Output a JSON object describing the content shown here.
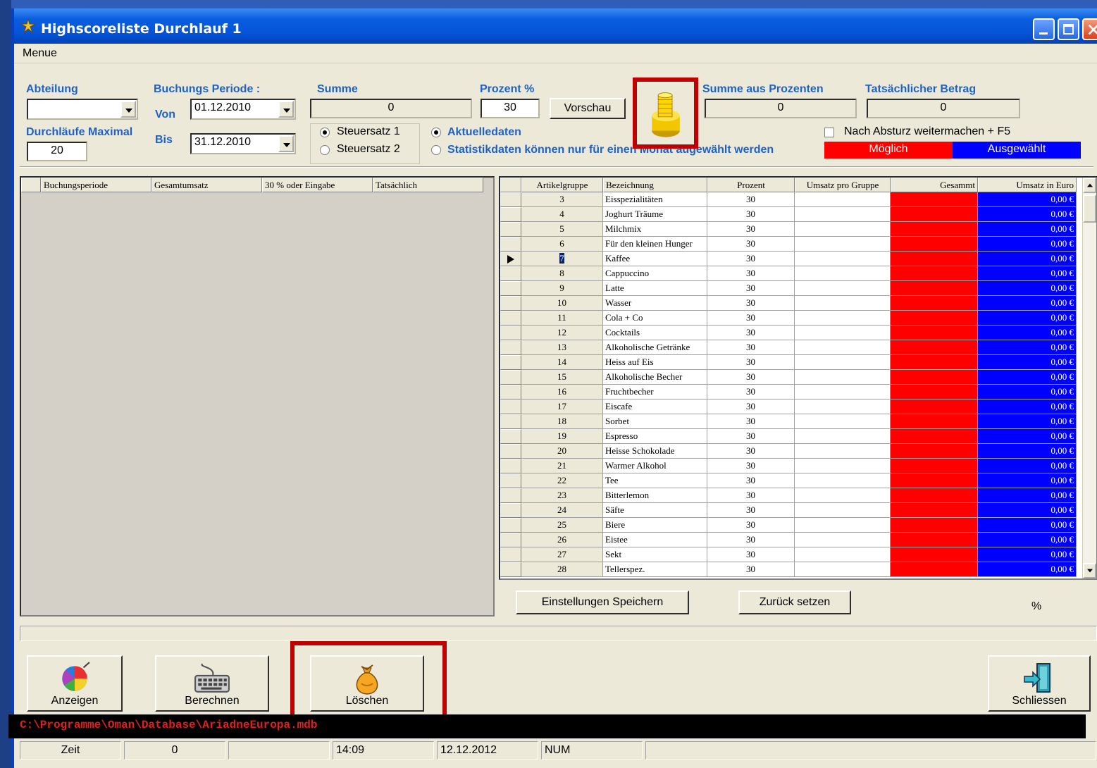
{
  "window": {
    "title": "Highscoreliste Durchlauf 1",
    "menu": "Menue"
  },
  "filters": {
    "abteilung_label": "Abteilung",
    "abteilung_value": "",
    "durchlaeufe_label": "Durchläufe Maximal",
    "durchlaeufe_value": "20",
    "periode_label": "Buchungs Periode :",
    "von_label": "Von",
    "von_value": "01.12.2010",
    "bis_label": "Bis",
    "bis_value": "31.12.2010",
    "summe_label": "Summe",
    "summe_value": "0",
    "prozent_label": "Prozent %",
    "prozent_value": "30",
    "vorschau_label": "Vorschau",
    "summe_prozent_label": "Summe aus Prozenten",
    "summe_prozent_value": "0",
    "betrag_label": "Tatsächlicher Betrag",
    "betrag_value": "0",
    "steuersatz1": "Steuersatz 1",
    "steuersatz2": "Steuersatz 2",
    "aktuelledaten": "Aktuelledaten",
    "statistikdaten": "Statistikdaten können nur für einen Monat augewählt werden",
    "absturz_label": "Nach Absturz weitermachen + F5",
    "moeglich_label": "Möglich",
    "ausgewaehlt_label": "Ausgewählt",
    "colors": {
      "moeglich": "#ff0000",
      "ausgewaehlt": "#0000ff"
    }
  },
  "left_grid": {
    "headers": [
      "Buchungsperiode",
      "Gesamtumsatz",
      "30 % oder Eingabe",
      "Tatsächlich"
    ]
  },
  "right_grid": {
    "headers": [
      "Artikelgruppe",
      "Bezeichnung",
      "Prozent",
      "Umsatz pro Gruppe",
      "Gesammt",
      "Umsatz in Euro"
    ],
    "current_row_index": 4,
    "rows": [
      {
        "grp": "3",
        "name": "Eisspezialitäten",
        "pct": "30",
        "eur": "0,00 €"
      },
      {
        "grp": "4",
        "name": "Joghurt Träume",
        "pct": "30",
        "eur": "0,00 €"
      },
      {
        "grp": "5",
        "name": "Milchmix",
        "pct": "30",
        "eur": "0,00 €"
      },
      {
        "grp": "6",
        "name": "Für den kleinen Hunger",
        "pct": "30",
        "eur": "0,00 €"
      },
      {
        "grp": "7",
        "name": "Kaffee",
        "pct": "30",
        "eur": "0,00 €"
      },
      {
        "grp": "8",
        "name": "Cappuccino",
        "pct": "30",
        "eur": "0,00 €"
      },
      {
        "grp": "9",
        "name": "Latte",
        "pct": "30",
        "eur": "0,00 €"
      },
      {
        "grp": "10",
        "name": "Wasser",
        "pct": "30",
        "eur": "0,00 €"
      },
      {
        "grp": "11",
        "name": "Cola + Co",
        "pct": "30",
        "eur": "0,00 €"
      },
      {
        "grp": "12",
        "name": "Cocktails",
        "pct": "30",
        "eur": "0,00 €"
      },
      {
        "grp": "13",
        "name": "Alkoholische Getränke",
        "pct": "30",
        "eur": "0,00 €"
      },
      {
        "grp": "14",
        "name": "Heiss auf Eis",
        "pct": "30",
        "eur": "0,00 €"
      },
      {
        "grp": "15",
        "name": "Alkoholische Becher",
        "pct": "30",
        "eur": "0,00 €"
      },
      {
        "grp": "16",
        "name": "Fruchtbecher",
        "pct": "30",
        "eur": "0,00 €"
      },
      {
        "grp": "17",
        "name": "Eiscafe",
        "pct": "30",
        "eur": "0,00 €"
      },
      {
        "grp": "18",
        "name": "Sorbet",
        "pct": "30",
        "eur": "0,00 €"
      },
      {
        "grp": "19",
        "name": "Espresso",
        "pct": "30",
        "eur": "0,00 €"
      },
      {
        "grp": "20",
        "name": "Heisse Schokolade",
        "pct": "30",
        "eur": "0,00 €"
      },
      {
        "grp": "21",
        "name": "Warmer Alkohol",
        "pct": "30",
        "eur": "0,00 €"
      },
      {
        "grp": "22",
        "name": "Tee",
        "pct": "30",
        "eur": "0,00 €"
      },
      {
        "grp": "23",
        "name": "Bitterlemon",
        "pct": "30",
        "eur": "0,00 €"
      },
      {
        "grp": "24",
        "name": "Säfte",
        "pct": "30",
        "eur": "0,00 €"
      },
      {
        "grp": "25",
        "name": "Biere",
        "pct": "30",
        "eur": "0,00 €"
      },
      {
        "grp": "26",
        "name": "Eistee",
        "pct": "30",
        "eur": "0,00 €"
      },
      {
        "grp": "27",
        "name": "Sekt",
        "pct": "30",
        "eur": "0,00 €"
      },
      {
        "grp": "28",
        "name": "Tellerspez.",
        "pct": "30",
        "eur": "0,00 €"
      }
    ]
  },
  "actions": {
    "einstellungen": "Einstellungen Speichern",
    "zuruck": "Zurück setzen",
    "percent_sign": "%",
    "anzeigen": "Anzeigen",
    "berechnen": "Berechnen",
    "loeschen": "Löschen",
    "schliessen": "Schliessen"
  },
  "status": {
    "path": "C:\\Programme\\Oman\\Database\\AriadneEuropa.mdb",
    "zeit_label": "Zeit",
    "count": "0",
    "blank": "",
    "time": "14:09",
    "date": "12.12.2012",
    "num": "NUM"
  },
  "icons": {
    "app": "sparkle-icon",
    "coins": "coin-stack-icon",
    "anzeigen": "pie-chart-icon",
    "berechnen": "keyboard-icon",
    "loeschen": "money-bag-icon",
    "schliessen": "exit-door-icon"
  }
}
